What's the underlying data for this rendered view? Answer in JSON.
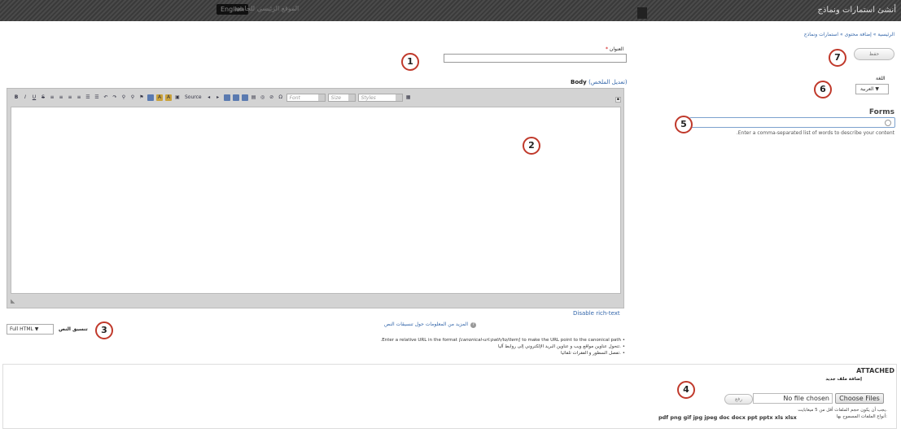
{
  "topbar": {
    "title": "أنشئ استمارات ونماذج",
    "site_link": "الموقع الرئيسي للجامعة",
    "lang_switch": "English"
  },
  "breadcrumb": "الرئيسية » إضافة محتوى » استمارات ونماذج",
  "save_label": "حفظ",
  "language": {
    "label": "اللغة",
    "value": "العربية ▼"
  },
  "forms_field": {
    "label": "Forms",
    "hint": ".Enter a comma-separated list of words to describe your content"
  },
  "title_field": {
    "label": "العنوان",
    "required": "*"
  },
  "body": {
    "label": "Body",
    "summary_link": "(تعديل الملخص)"
  },
  "toolbar": {
    "buttons": [
      "B",
      "I",
      "U",
      "S",
      "≡",
      "≡",
      "≡",
      "≡",
      "☰",
      "☰",
      "↶",
      "↷",
      "⚲",
      "⚲",
      "⚑",
      "▦",
      "A",
      "A",
      "▣"
    ],
    "source": "Source",
    "buttons2": [
      "◂",
      "▸",
      "▤",
      "▦",
      "▦",
      "▤",
      "◎",
      "⊘",
      "Ω"
    ],
    "font": "Font",
    "size": "Size",
    "styles": "Styles",
    "grid": "▦",
    "collapse": "▪"
  },
  "disable_rich_text": "Disable rich-text",
  "text_format": {
    "label": "تنسيق النص",
    "value": "Full HTML ▼"
  },
  "more_format_link": "المزيد من المعلومات حول تنسيقات النص",
  "tips": {
    "line1_suffix": "to make the URL point to the canonical path",
    "line1_code": "[canonical-url:path/to/item]",
    "line1_prefix": ".Enter a relative URL in the format",
    "line2": "تتحول عناوين مواقع ويب و عناوين البريد الإلكتروني إلى روابط آليا.",
    "line3": "تفصل السطور و الفقرات تلقائيا."
  },
  "attached": {
    "title": "ATTACHED",
    "add_label": "إضافة ملف جديد",
    "upload_label": "رفع",
    "file_status": "No file chosen",
    "choose_label": "Choose Files",
    "size_note": "يجب أن يكون حجم الملفات أقل من 5 ميغابايت.",
    "types_note": "أنواع الملفات المسموح بها:",
    "extensions": "pdf png gif jpg jpeg doc docx ppt pptx xls xlsx"
  },
  "callouts": [
    "1",
    "2",
    "3",
    "4",
    "5",
    "6",
    "7"
  ],
  "colors": {
    "accent": "#c0392b",
    "link": "#3366aa",
    "topbar": "#444444"
  }
}
